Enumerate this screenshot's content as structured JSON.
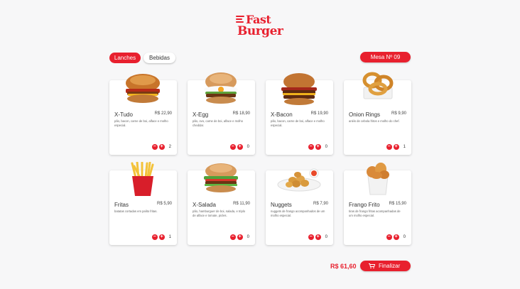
{
  "brand": {
    "line1": "Fast",
    "line2": "Burger"
  },
  "tabs": [
    {
      "label": "Lanches",
      "active": true
    },
    {
      "label": "Bebidas",
      "active": false
    }
  ],
  "table_label": "Mesa Nº 09",
  "products": [
    {
      "name": "X-Tudo",
      "price": "R$ 22,90",
      "desc": "pão, bacon, carne de boi, alface e molho especial.",
      "count": "2",
      "icon": "burger-icon"
    },
    {
      "name": "X-Egg",
      "price": "R$ 18,90",
      "desc": "pão, ovo, carne de boi, alface e molho cheddar.",
      "count": "0",
      "icon": "egg-burger-icon"
    },
    {
      "name": "X-Bacon",
      "price": "R$ 19,90",
      "desc": "pão, bacon, carne de boi, alface e molho especial.",
      "count": "0",
      "icon": "bacon-burger-icon"
    },
    {
      "name": "Onion Rings",
      "price": "R$ 9,90",
      "desc": "anéis de cebola fritos e molho do chef.",
      "count": "1",
      "icon": "onion-rings-icon"
    },
    {
      "name": "Fritas",
      "price": "R$ 5,90",
      "desc": "batatas cortadas em palito fritas.",
      "count": "1",
      "icon": "fries-icon"
    },
    {
      "name": "X-Salada",
      "price": "R$ 11,90",
      "desc": "pão, hamburguer de boi, salada, e triplo de alface e tomate, picles.",
      "count": "0",
      "icon": "salad-burger-icon"
    },
    {
      "name": "Nuggets",
      "price": "R$ 7,90",
      "desc": "nuggets de frango acompanhados de um molho especial.",
      "count": "0",
      "icon": "nuggets-icon"
    },
    {
      "name": "Frango Frito",
      "price": "R$ 15,90",
      "desc": "tiras de frango fritas acompanhadas de um molho especial.",
      "count": "0",
      "icon": "fried-chicken-icon"
    }
  ],
  "controls": {
    "minus": "−",
    "plus": "+"
  },
  "total": "R$ 61,60",
  "finish_label": "Finalizar",
  "colors": {
    "accent": "#e8202e",
    "background": "#f7f7f8"
  }
}
